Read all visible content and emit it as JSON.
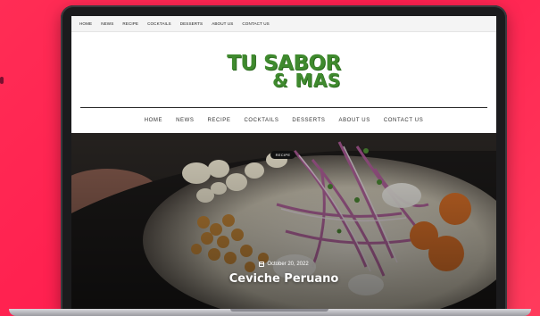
{
  "topbar": {
    "items": [
      "HOME",
      "NEWS",
      "RECIPE",
      "COCKTAILS",
      "DESSERTS",
      "ABOUT US",
      "CONTACT US"
    ]
  },
  "logo": {
    "line1": "TU SABOR",
    "line2": "& MAS"
  },
  "mainnav": {
    "items": [
      "HOME",
      "NEWS",
      "RECIPE",
      "COCKTAILS",
      "DESSERTS",
      "ABOUT US",
      "CONTACT US"
    ]
  },
  "hero": {
    "category_badge": "RECIPE",
    "date": "October 20, 2022",
    "title": "Ceviche Peruano"
  },
  "colors": {
    "background": "#ff2d55",
    "logo_green": "#3f8a2e"
  }
}
